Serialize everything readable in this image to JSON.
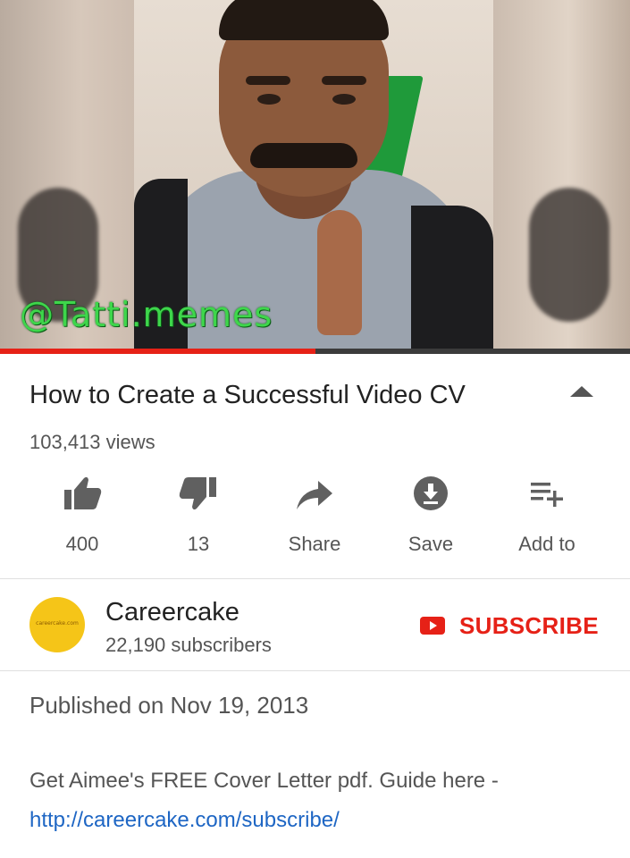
{
  "video": {
    "watermark": "@Tatti.memes",
    "progress_fraction": 0.5
  },
  "title": "How to Create a Successful Video CV",
  "views": "103,413 views",
  "actions": {
    "like_count": "400",
    "dislike_count": "13",
    "share_label": "Share",
    "save_label": "Save",
    "add_to_label": "Add to"
  },
  "channel": {
    "name": "Careercake",
    "subscribers": "22,190 subscribers",
    "avatar_text": "careercake.com",
    "subscribe_label": "SUBSCRIBE"
  },
  "description": {
    "published": "Published on Nov 19, 2013",
    "text": "Get Aimee's FREE Cover Letter pdf. Guide here -",
    "link": "http://careercake.com/subscribe/"
  },
  "colors": {
    "accent_red": "#e62117",
    "link_blue": "#1e66c4",
    "watermark_green": "#3ed64b"
  },
  "icons": [
    "thumbs-up-icon",
    "thumbs-down-icon",
    "share-icon",
    "save-icon",
    "add-to-playlist-icon",
    "collapse-arrow-icon",
    "youtube-logo-icon"
  ]
}
